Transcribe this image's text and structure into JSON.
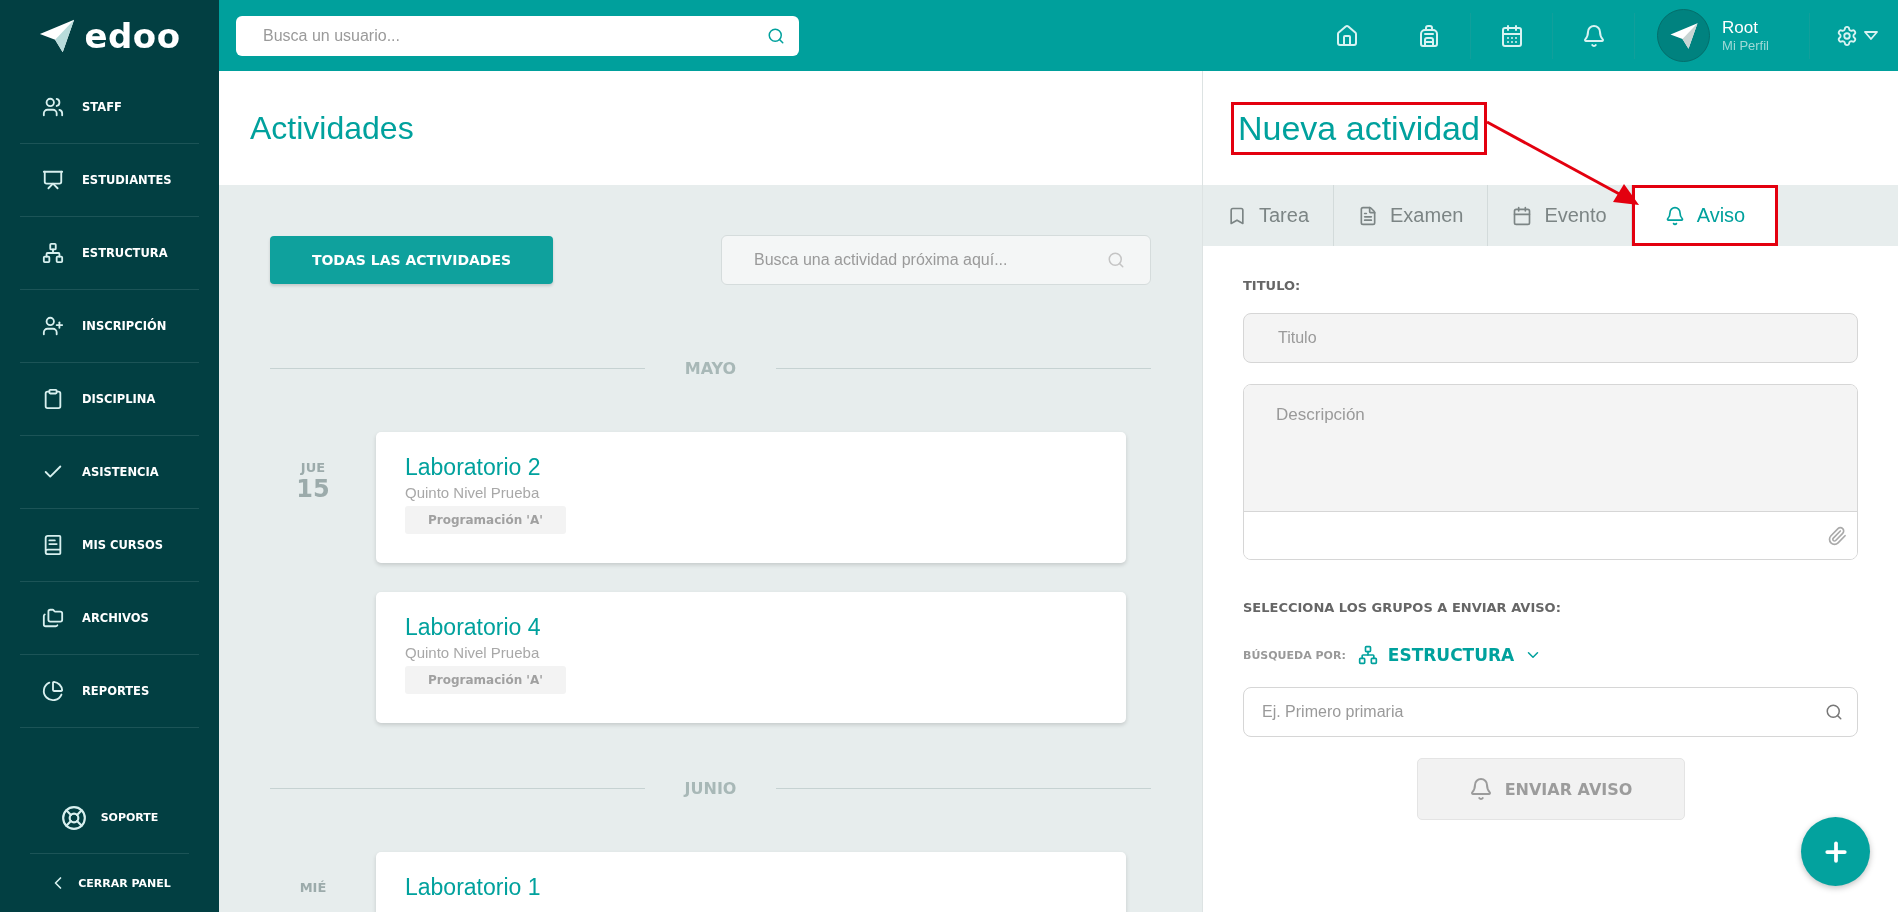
{
  "logo": {
    "text": "edoo"
  },
  "sidebar": {
    "items": [
      {
        "label": "STAFF"
      },
      {
        "label": "ESTUDIANTES"
      },
      {
        "label": "ESTRUCTURA"
      },
      {
        "label": "INSCRIPCIÓN"
      },
      {
        "label": "DISCIPLINA"
      },
      {
        "label": "ASISTENCIA"
      },
      {
        "label": "MIS CURSOS"
      },
      {
        "label": "ARCHIVOS"
      },
      {
        "label": "REPORTES"
      }
    ],
    "support": "SOPORTE",
    "close_panel": "CERRAR PANEL"
  },
  "topbar": {
    "search": {
      "placeholder": "Busca un usuario..."
    },
    "user": {
      "name": "Root",
      "link": "Mi Perfil"
    }
  },
  "activities": {
    "title": "Actividades",
    "all_button": "TODAS LAS ACTIVIDADES",
    "search": {
      "placeholder": "Busca una actividad próxima aquí..."
    },
    "months": [
      {
        "name": "MAYO",
        "days": [
          {
            "weekday": "JUE",
            "day": "15",
            "items": [
              {
                "title": "Laboratorio 2",
                "subtitle": "Quinto Nivel Prueba",
                "tag": "Programación 'A'"
              },
              {
                "title": "Laboratorio 4",
                "subtitle": "Quinto Nivel Prueba",
                "tag": "Programación 'A'"
              }
            ]
          }
        ]
      },
      {
        "name": "JUNIO",
        "days": [
          {
            "weekday": "MIÉ",
            "items": [
              {
                "title": "Laboratorio 1"
              }
            ]
          }
        ]
      }
    ]
  },
  "new_activity": {
    "title": "Nueva actividad",
    "highlighted": true,
    "tabs": [
      {
        "label": "Tarea",
        "selected": false,
        "highlighted": false
      },
      {
        "label": "Examen",
        "selected": false,
        "highlighted": false
      },
      {
        "label": "Evento",
        "selected": false,
        "highlighted": false
      },
      {
        "label": "Aviso",
        "selected": true,
        "highlighted": true
      }
    ],
    "arrow": true,
    "title_label": "TITULO:",
    "title_field": {
      "placeholder": "Titulo"
    },
    "description": {
      "placeholder": "Descripción"
    },
    "groups_label": "SELECCIONA LOS GRUPOS A ENVIAR AVISO:",
    "search_by_label": "BÚSQUEDA POR:",
    "search_by_value": "ESTRUCTURA",
    "group_search": {
      "placeholder": "Ej. Primero primaria"
    },
    "send_button": {
      "label": "ENVIAR AVISO",
      "disabled": true
    }
  }
}
